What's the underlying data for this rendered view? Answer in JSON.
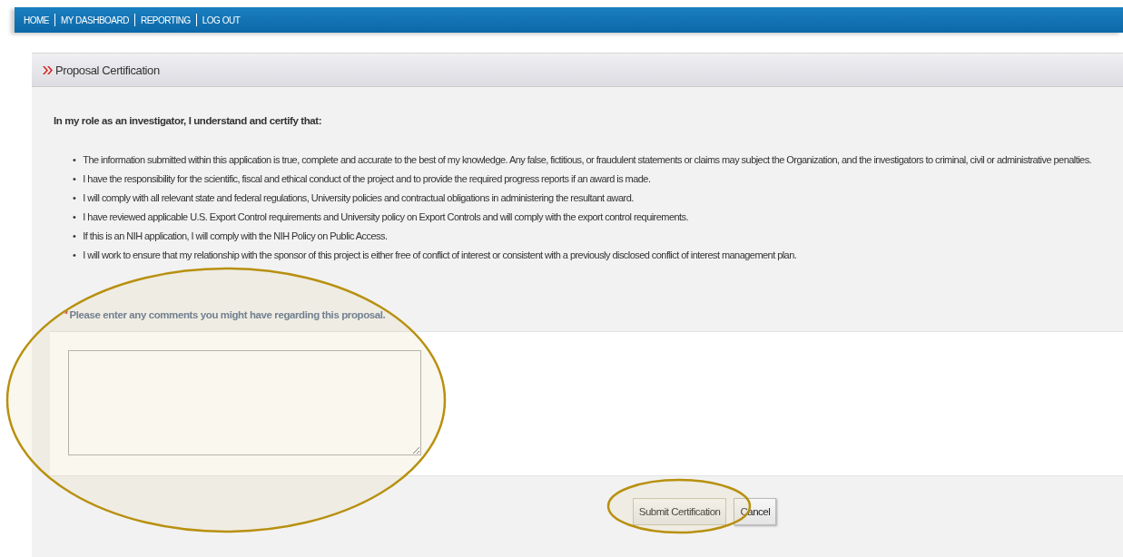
{
  "nav": [
    {
      "label": "HOME"
    },
    {
      "label": "MY DASHBOARD"
    },
    {
      "label": "REPORTING"
    },
    {
      "label": "LOG OUT"
    }
  ],
  "panel": {
    "title": "Proposal Certification",
    "intro": "In my role as an investigator, I understand and certify that:",
    "statements": [
      "The information submitted within this application is true, complete and accurate to the best of my knowledge. Any false, fictitious, or fraudulent statements or claims may subject the Organization, and the investigators to criminal, civil or administrative penalties.",
      "I have the responsibility for the scientific, fiscal and ethical conduct of the project and to provide the required progress reports if an award is made.",
      "I will comply with all relevant state and federal regulations, University policies and contractual obligations in administering the resultant award.",
      "I have reviewed applicable U.S. Export Control requirements and University policy on Export Controls and will comply with the export control requirements.",
      "If this is an NIH application, I will comply with the NIH Policy on Public Access.",
      "I will work to ensure that my relationship with the sponsor of this project is either free of conflict of interest or consistent with a previously disclosed conflict of interest management plan."
    ],
    "bullet": "•",
    "comments": {
      "required": true,
      "required_mark": "*",
      "label": "Please enter any comments you might have regarding this proposal."
    },
    "buttons": [
      {
        "label": "Submit Certification",
        "kind": "primary"
      },
      {
        "label": "Cancel",
        "kind": "secondary"
      }
    ]
  }
}
